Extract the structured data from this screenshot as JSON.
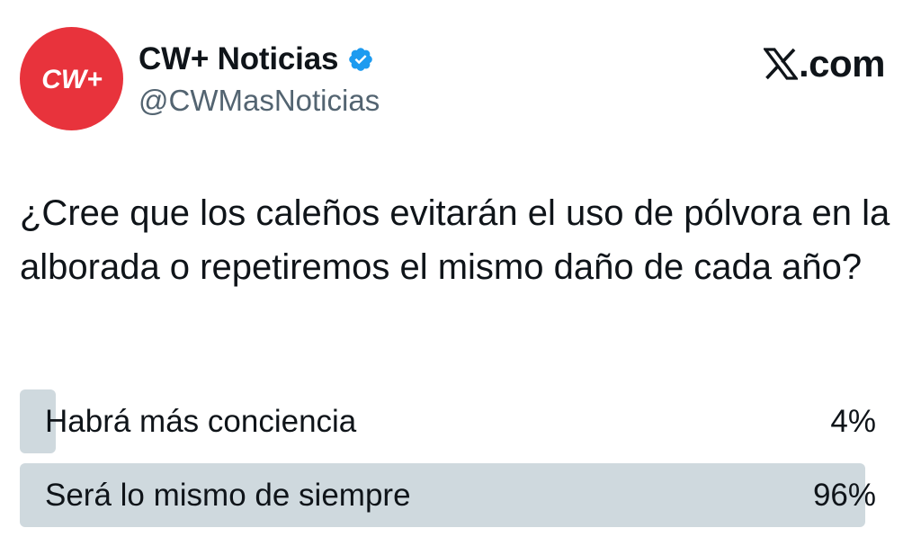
{
  "account": {
    "display_name": "CW+ Noticias",
    "handle": "@CWMasNoticias",
    "avatar_text": "CW+",
    "avatar_color": "#e8333c",
    "verified": true,
    "verified_color": "#1d9bf0"
  },
  "brand": {
    "logo_icon": "x-logo-icon",
    "text": ".com"
  },
  "tweet": {
    "text": "¿Cree que los caleños evitarán el uso de pólvora en la alborada o repetiremos el mismo daño de cada año?"
  },
  "poll": {
    "bar_color": "#cfd9de",
    "options": [
      {
        "label": "Habrá más conciencia",
        "percent_label": "4%",
        "value": 4
      },
      {
        "label": "Será lo mismo de siempre",
        "percent_label": "96%",
        "value": 96
      }
    ]
  }
}
